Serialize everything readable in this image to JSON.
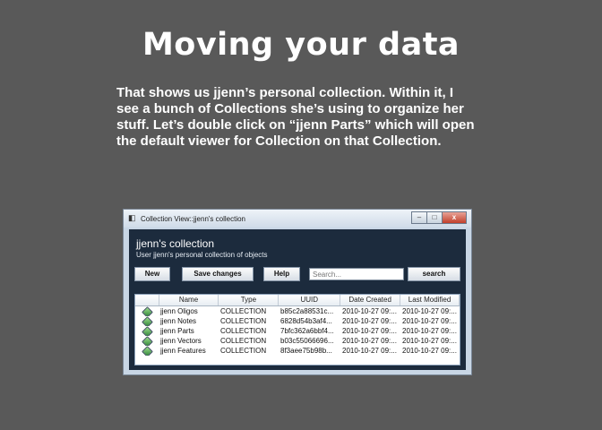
{
  "slide": {
    "title": "Moving your data",
    "body": "That shows us jjenn’s personal collection.  Within it, I see a bunch of Collections she’s using to organize her stuff.  Let’s double click on “jjenn Parts” which will open the default viewer for Collection on that Collection."
  },
  "window": {
    "title": "Collection View::jjenn's collection",
    "collection_title": "jjenn's collection",
    "collection_subtitle": "User jjenn's personal collection of objects",
    "controls": {
      "minimize": "–",
      "maximize": "□",
      "close": "x"
    }
  },
  "toolbar": {
    "new_label": "New",
    "save_label": "Save changes",
    "help_label": "Help",
    "search_placeholder": "Search...",
    "search_button_label": "search"
  },
  "table": {
    "columns": [
      "",
      "Name",
      "Type",
      "UUID",
      "Date Created",
      "Last Modified"
    ],
    "rows": [
      {
        "icon": "collection-icon",
        "name": "jjenn Oligos",
        "type": "COLLECTION",
        "uuid": "b85c2a88531c...",
        "created": "2010-10-27 09:...",
        "modified": "2010-10-27 09:..."
      },
      {
        "icon": "collection-icon",
        "name": "jjenn Notes",
        "type": "COLLECTION",
        "uuid": "6828d54b3af4...",
        "created": "2010-10-27 09:...",
        "modified": "2010-10-27 09:..."
      },
      {
        "icon": "collection-icon",
        "name": "jjenn Parts",
        "type": "COLLECTION",
        "uuid": "7bfc362a6bbf4...",
        "created": "2010-10-27 09:...",
        "modified": "2010-10-27 09:..."
      },
      {
        "icon": "collection-icon",
        "name": "jjenn Vectors",
        "type": "COLLECTION",
        "uuid": "b03c55066696...",
        "created": "2010-10-27 09:...",
        "modified": "2010-10-27 09:..."
      },
      {
        "icon": "collection-icon",
        "name": "jjenn Features",
        "type": "COLLECTION",
        "uuid": "8f3aee75b98b...",
        "created": "2010-10-27 09:...",
        "modified": "2010-10-27 09:..."
      }
    ]
  }
}
